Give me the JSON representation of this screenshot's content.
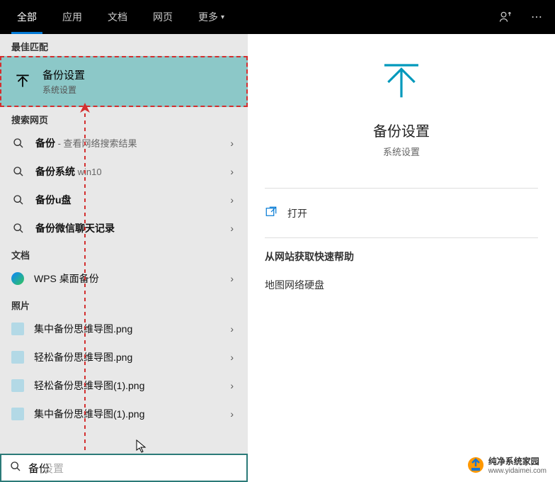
{
  "header": {
    "tabs": [
      "全部",
      "应用",
      "文档",
      "网页",
      "更多"
    ]
  },
  "left": {
    "bestMatchLabel": "最佳匹配",
    "bestMatch": {
      "title": "备份设置",
      "subtitle": "系统设置"
    },
    "webLabel": "搜索网页",
    "webItems": [
      {
        "bold": "备份",
        "rest": " - 查看网络搜索结果"
      },
      {
        "bold": "备份系统",
        "rest": " win10"
      },
      {
        "bold": "备份u盘",
        "rest": ""
      },
      {
        "bold": "备份微信聊天记录",
        "rest": ""
      }
    ],
    "docsLabel": "文档",
    "docs": [
      {
        "name": "WPS 桌面备份"
      }
    ],
    "photosLabel": "照片",
    "photos": [
      {
        "name": "集中备份思维导图.png"
      },
      {
        "name": "轻松备份思维导图.png"
      },
      {
        "name": "轻松备份思维导图(1).png"
      },
      {
        "name": "集中备份思维导图(1).png"
      }
    ]
  },
  "right": {
    "title": "备份设置",
    "subtitle": "系统设置",
    "open": "打开",
    "helpHeading": "从网站获取快速帮助",
    "helpLink": "地图网络硬盘"
  },
  "search": {
    "value": "备份",
    "placeholder": "设置"
  },
  "watermark": {
    "brand": "纯净系统家园",
    "url": "www.yidaimei.com"
  }
}
